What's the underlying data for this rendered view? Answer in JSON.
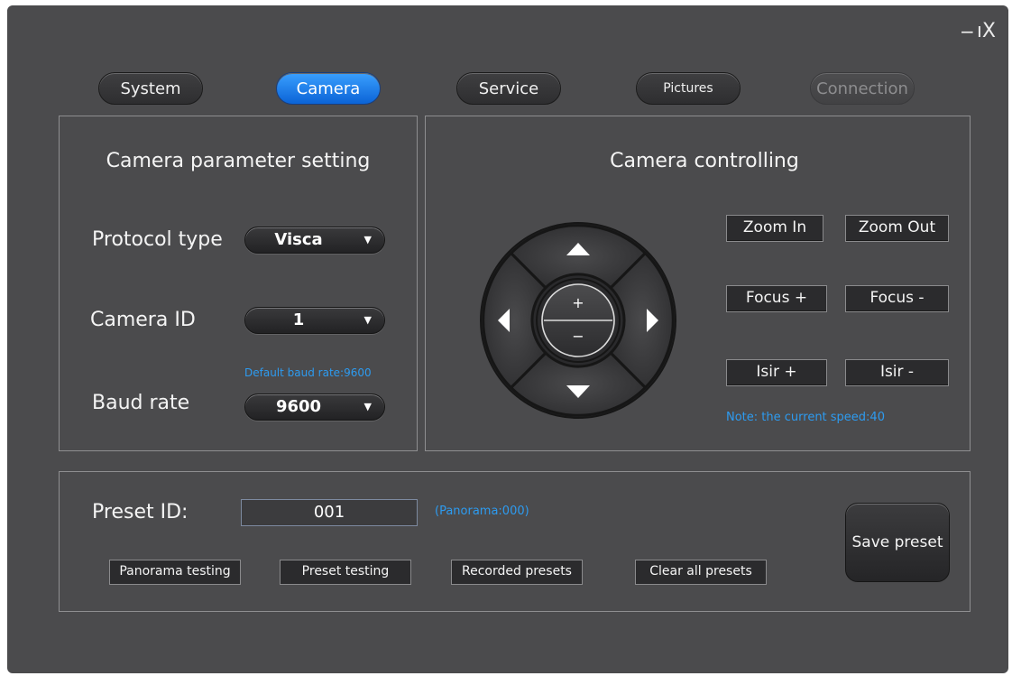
{
  "window": {
    "minimize_glyph": "−",
    "close_glyph": "ıX"
  },
  "tabs": [
    {
      "label": "System"
    },
    {
      "label": "Camera"
    },
    {
      "label": "Service"
    },
    {
      "label": "Pictures"
    },
    {
      "label": "Connection"
    }
  ],
  "param_panel": {
    "title": "Camera parameter setting",
    "protocol_label": "Protocol type",
    "protocol_value": "Visca",
    "camera_id_label": "Camera ID",
    "camera_id_value": "1",
    "baud_hint": "Default baud rate:9600",
    "baud_label": "Baud rate",
    "baud_value": "9600"
  },
  "control_panel": {
    "title": "Camera controlling",
    "zoom_in": "Zoom In",
    "zoom_out": "Zoom Out",
    "focus_plus": "Focus +",
    "focus_minus": "Focus -",
    "isir_plus": "Isir +",
    "isir_minus": "Isir -",
    "speed_note": "Note: the current speed:40",
    "dpad_plus": "+",
    "dpad_minus": "−"
  },
  "preset_panel": {
    "preset_label": "Preset ID:",
    "preset_value": "001",
    "panorama_hint": "(Panorama:000)",
    "panorama_testing": "Panorama testing",
    "preset_testing": "Preset testing",
    "recorded_presets": "Recorded presets",
    "clear_all_presets": "Clear all presets",
    "save_preset": "Save preset"
  },
  "icons": {
    "up": "triangle-up-icon",
    "down": "triangle-down-icon",
    "left": "triangle-left-icon",
    "right": "triangle-right-icon",
    "dropdown": "chevron-down-icon"
  },
  "colors": {
    "accent": "#1a7ff0",
    "hint": "#2d9bf0",
    "background": "#4b4b4d"
  }
}
